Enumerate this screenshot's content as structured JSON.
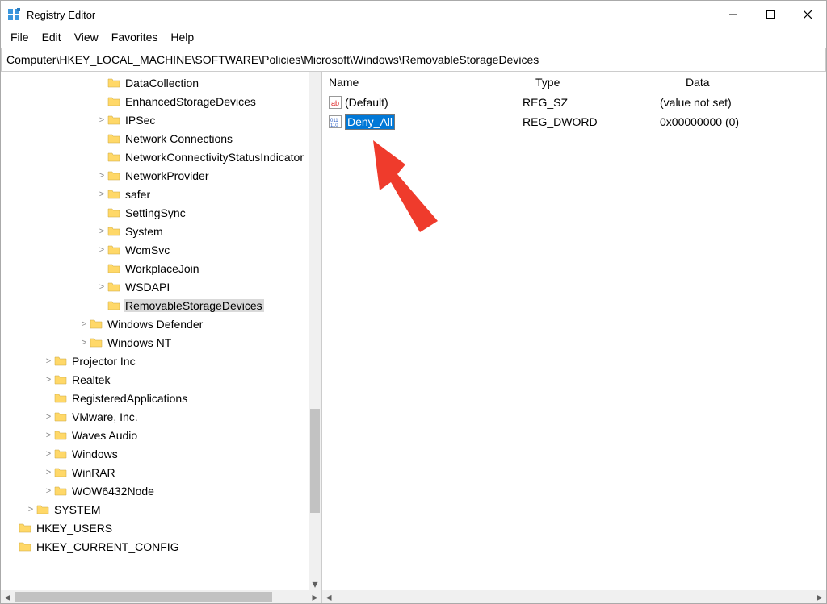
{
  "title": "Registry Editor",
  "window": {
    "min": "—",
    "max": "▢",
    "close": "✕"
  },
  "menu": {
    "file": "File",
    "edit": "Edit",
    "view": "View",
    "favorites": "Favorites",
    "help": "Help"
  },
  "address": "Computer\\HKEY_LOCAL_MACHINE\\SOFTWARE\\Policies\\Microsoft\\Windows\\RemovableStorageDevices",
  "columns": {
    "name": "Name",
    "type": "Type",
    "data": "Data"
  },
  "values": [
    {
      "icon": "ab",
      "name": "(Default)",
      "type": "REG_SZ",
      "data": "(value not set)",
      "editing": false
    },
    {
      "icon": "dw",
      "name": "Deny_All",
      "type": "REG_DWORD",
      "data": "0x00000000 (0)",
      "editing": true
    }
  ],
  "tree": [
    {
      "d": 5,
      "exp": "",
      "name": "DataCollection"
    },
    {
      "d": 5,
      "exp": "",
      "name": "EnhancedStorageDevices"
    },
    {
      "d": 5,
      "exp": ">",
      "name": "IPSec"
    },
    {
      "d": 5,
      "exp": "",
      "name": "Network Connections"
    },
    {
      "d": 5,
      "exp": "",
      "name": "NetworkConnectivityStatusIndicator"
    },
    {
      "d": 5,
      "exp": ">",
      "name": "NetworkProvider"
    },
    {
      "d": 5,
      "exp": ">",
      "name": "safer"
    },
    {
      "d": 5,
      "exp": "",
      "name": "SettingSync"
    },
    {
      "d": 5,
      "exp": ">",
      "name": "System"
    },
    {
      "d": 5,
      "exp": ">",
      "name": "WcmSvc"
    },
    {
      "d": 5,
      "exp": "",
      "name": "WorkplaceJoin"
    },
    {
      "d": 5,
      "exp": ">",
      "name": "WSDAPI"
    },
    {
      "d": 5,
      "exp": "",
      "name": "RemovableStorageDevices",
      "selected": true
    },
    {
      "d": 4,
      "exp": ">",
      "name": "Windows Defender"
    },
    {
      "d": 4,
      "exp": ">",
      "name": "Windows NT"
    },
    {
      "d": 2,
      "exp": ">",
      "name": "Projector Inc"
    },
    {
      "d": 2,
      "exp": ">",
      "name": "Realtek"
    },
    {
      "d": 2,
      "exp": "",
      "name": "RegisteredApplications"
    },
    {
      "d": 2,
      "exp": ">",
      "name": "VMware, Inc."
    },
    {
      "d": 2,
      "exp": ">",
      "name": "Waves Audio"
    },
    {
      "d": 2,
      "exp": ">",
      "name": "Windows"
    },
    {
      "d": 2,
      "exp": ">",
      "name": "WinRAR"
    },
    {
      "d": 2,
      "exp": ">",
      "name": "WOW6432Node"
    },
    {
      "d": 1,
      "exp": ">",
      "name": "SYSTEM"
    },
    {
      "d": 0,
      "exp": "",
      "name": "HKEY_USERS"
    },
    {
      "d": 0,
      "exp": "",
      "name": "HKEY_CURRENT_CONFIG"
    }
  ]
}
